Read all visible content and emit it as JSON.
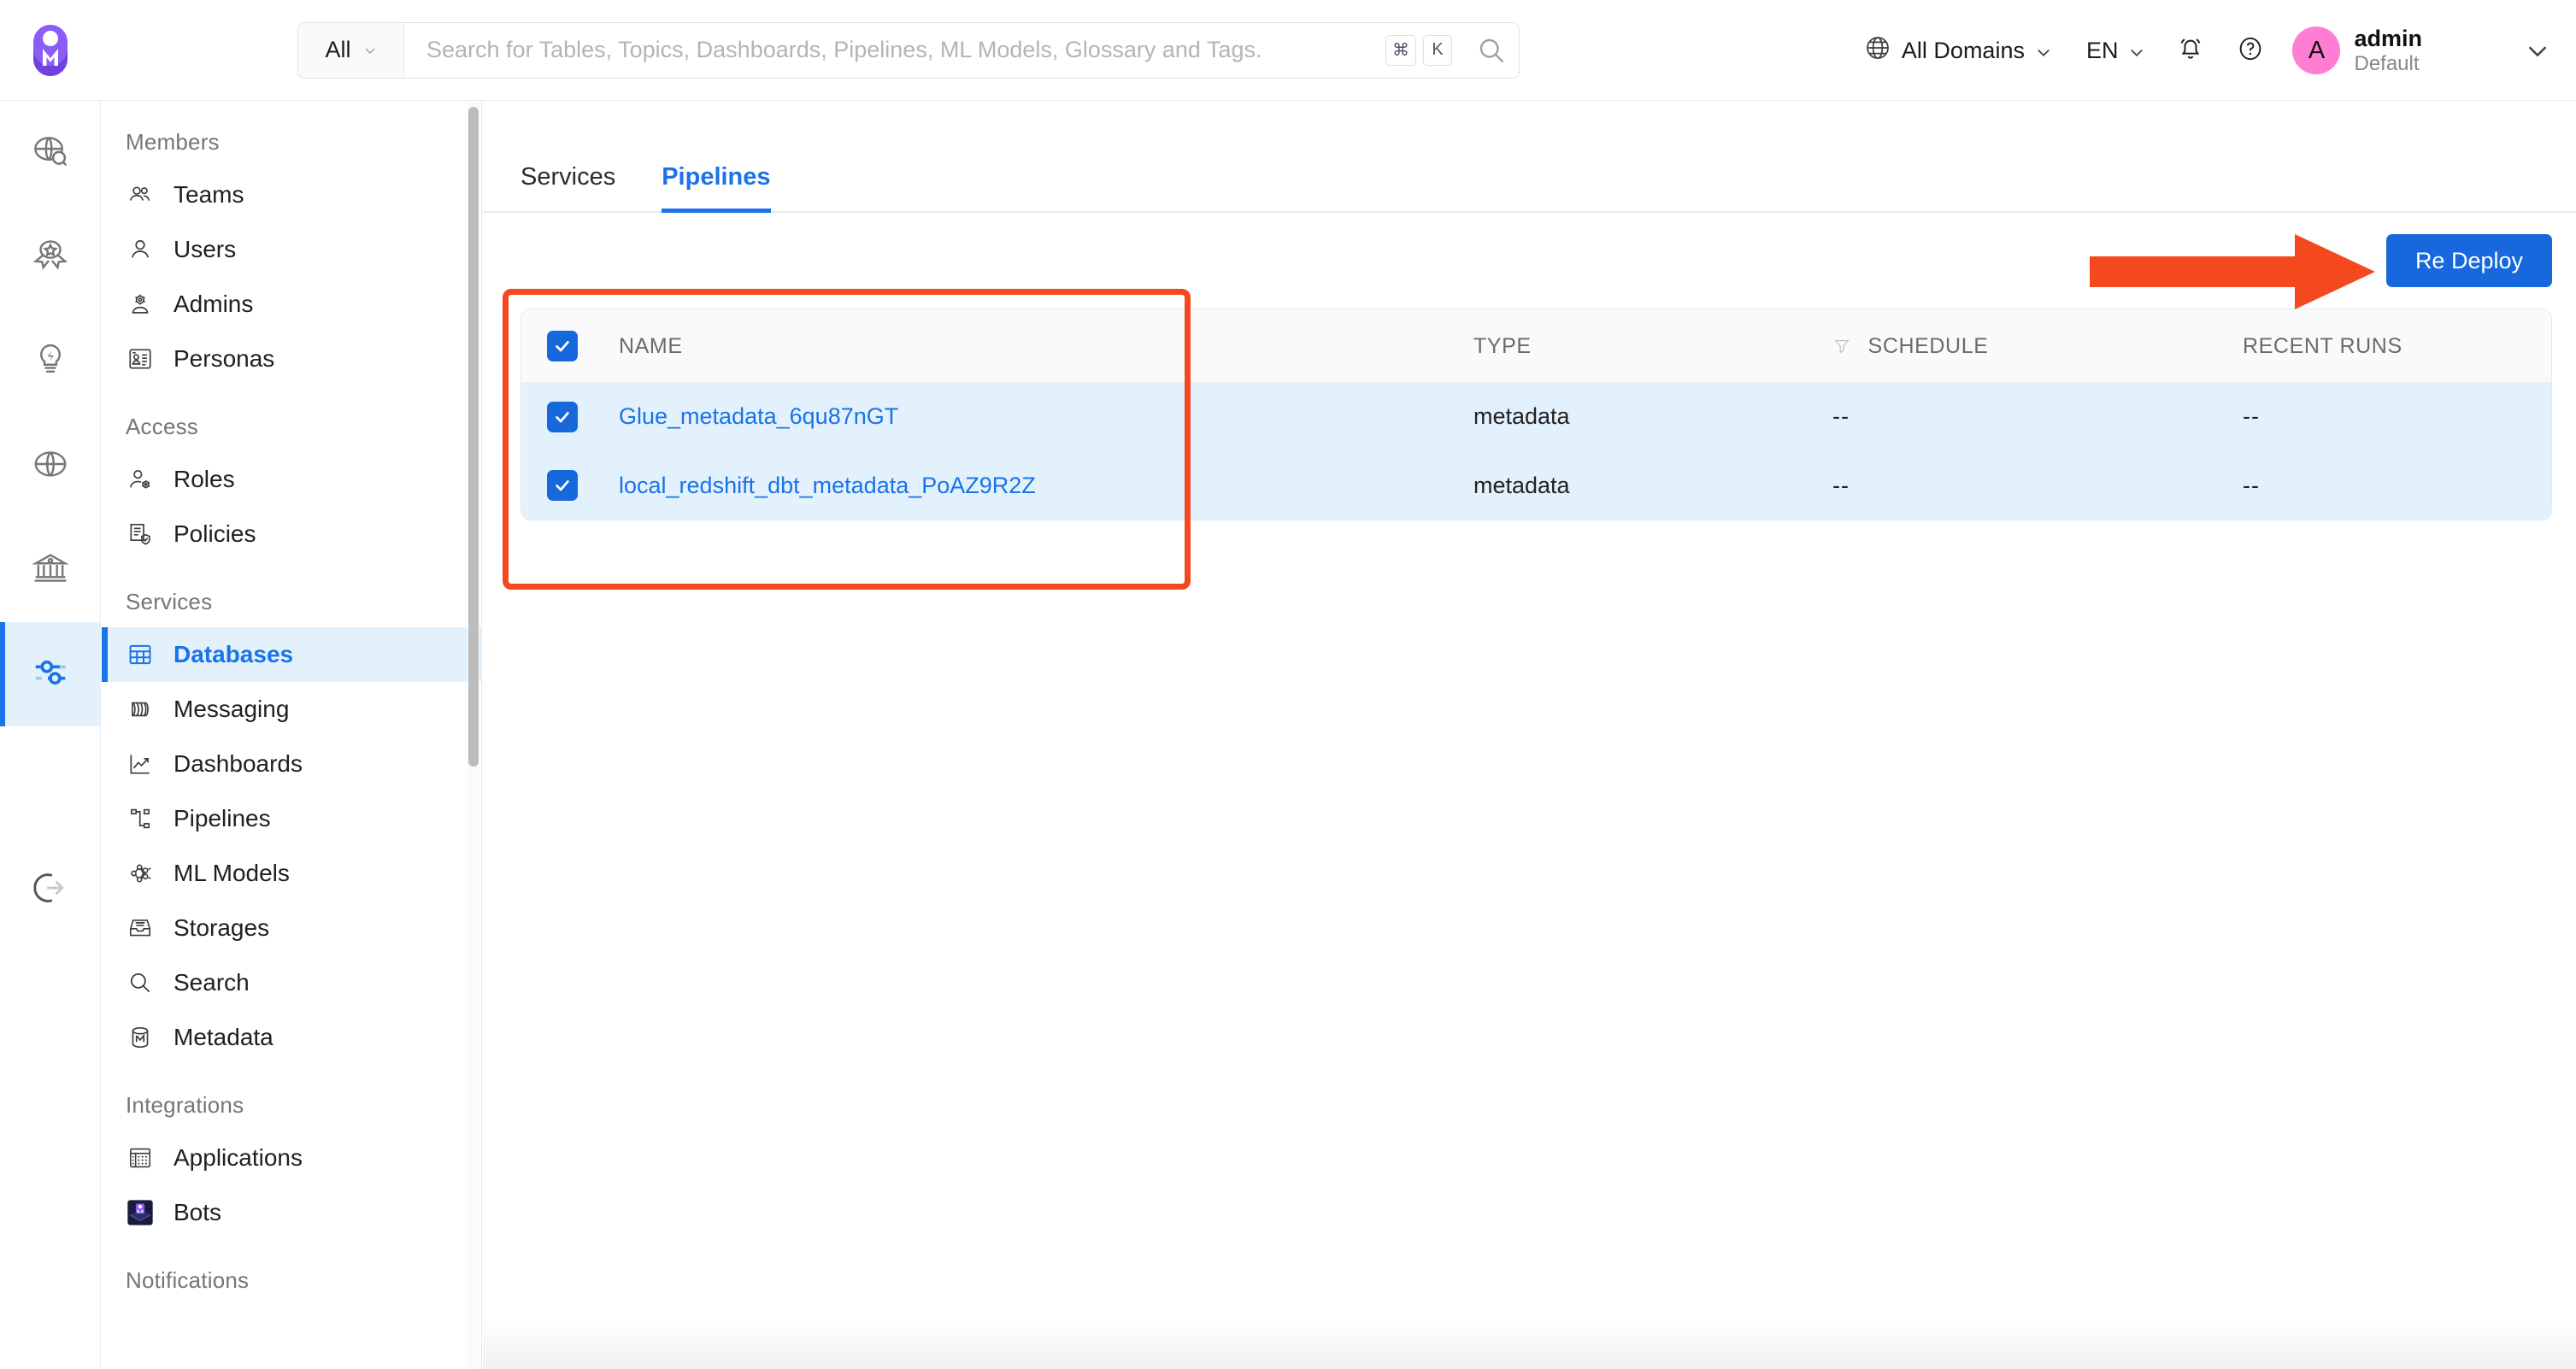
{
  "brand": {
    "accent": "#1a73e8",
    "primary_button": "#1668dc",
    "annotation": "#f4491f",
    "avatar_bg": "#ff7dd3"
  },
  "header": {
    "logo_name": "openmetadata-logo",
    "search": {
      "scope_label": "All",
      "placeholder": "Search for Tables, Topics, Dashboards, Pipelines, ML Models, Glossary and Tags.",
      "value": "",
      "shortcut_keys": [
        "⌘",
        "K"
      ]
    },
    "domain_selector": "All Domains",
    "language_selector": "EN",
    "notifications_icon": "bell-icon",
    "help_icon": "help-circle-icon",
    "user": {
      "avatar_initial": "A",
      "name": "admin",
      "subtitle": "Default"
    }
  },
  "rail": {
    "items": [
      {
        "name": "explore-icon",
        "label": "Explore",
        "active": false
      },
      {
        "name": "quality-icon",
        "label": "Data Quality",
        "active": false
      },
      {
        "name": "insights-icon",
        "label": "Insights",
        "active": false
      },
      {
        "name": "domains-icon",
        "label": "Domains",
        "active": false
      },
      {
        "name": "govern-icon",
        "label": "Govern",
        "active": false
      },
      {
        "name": "settings-icon",
        "label": "Settings",
        "active": true
      },
      {
        "name": "logout-icon",
        "label": "Logout",
        "active": false
      }
    ]
  },
  "sidebar": {
    "groups": [
      {
        "title": "Members",
        "items": [
          {
            "label": "Teams",
            "icon": "teams-icon",
            "active": false
          },
          {
            "label": "Users",
            "icon": "user-icon",
            "active": false
          },
          {
            "label": "Admins",
            "icon": "admin-icon",
            "active": false
          },
          {
            "label": "Personas",
            "icon": "persona-icon",
            "active": false
          }
        ]
      },
      {
        "title": "Access",
        "items": [
          {
            "label": "Roles",
            "icon": "roles-icon",
            "active": false
          },
          {
            "label": "Policies",
            "icon": "policies-icon",
            "active": false
          }
        ]
      },
      {
        "title": "Services",
        "items": [
          {
            "label": "Databases",
            "icon": "database-icon",
            "active": true
          },
          {
            "label": "Messaging",
            "icon": "messaging-icon",
            "active": false
          },
          {
            "label": "Dashboards",
            "icon": "dashboard-icon",
            "active": false
          },
          {
            "label": "Pipelines",
            "icon": "pipeline-icon",
            "active": false
          },
          {
            "label": "ML Models",
            "icon": "mlmodel-icon",
            "active": false
          },
          {
            "label": "Storages",
            "icon": "storage-icon",
            "active": false
          },
          {
            "label": "Search",
            "icon": "search-icon",
            "active": false
          },
          {
            "label": "Metadata",
            "icon": "metadata-icon",
            "active": false
          }
        ]
      },
      {
        "title": "Integrations",
        "items": [
          {
            "label": "Applications",
            "icon": "applications-icon",
            "active": false
          },
          {
            "label": "Bots",
            "icon": "bots-icon",
            "active": false
          }
        ]
      },
      {
        "title": "Notifications",
        "items": []
      }
    ]
  },
  "main": {
    "tabs": [
      {
        "label": "Services",
        "active": false
      },
      {
        "label": "Pipelines",
        "active": true
      }
    ],
    "redeploy_button": "Re Deploy",
    "table": {
      "select_all_checked": true,
      "columns": [
        {
          "key": "name",
          "label": "NAME",
          "filter": false
        },
        {
          "key": "type",
          "label": "TYPE",
          "filter": false
        },
        {
          "key": "schedule",
          "label": "SCHEDULE",
          "filter": true
        },
        {
          "key": "runs",
          "label": "RECENT RUNS",
          "filter": false
        }
      ],
      "rows": [
        {
          "checked": true,
          "name": "Glue_metadata_6qu87nGT",
          "type": "metadata",
          "schedule": "--",
          "runs": "--"
        },
        {
          "checked": true,
          "name": "local_redshift_dbt_metadata_PoAZ9R2Z",
          "type": "metadata",
          "schedule": "--",
          "runs": "--"
        }
      ]
    }
  },
  "annotations": {
    "highlight_box": "table-highlight-box",
    "arrow": "redeploy-pointer-arrow"
  }
}
